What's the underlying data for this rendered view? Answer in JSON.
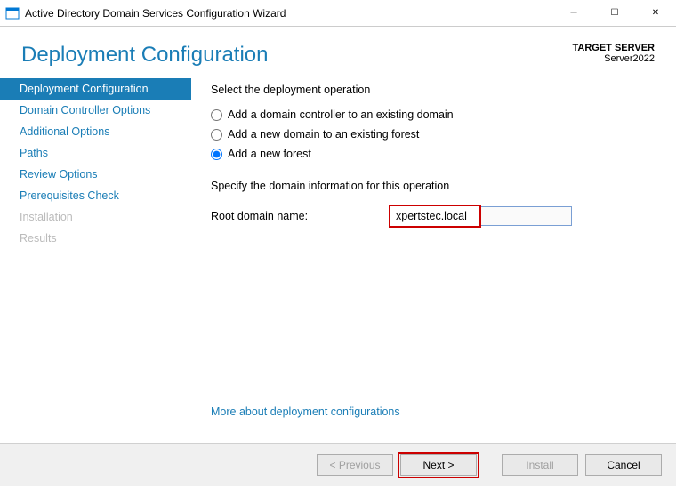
{
  "titlebar": {
    "title": "Active Directory Domain Services Configuration Wizard"
  },
  "header": {
    "page_title": "Deployment Configuration",
    "target_label": "TARGET SERVER",
    "target_server": "Server2022"
  },
  "sidebar": {
    "items": [
      {
        "label": "Deployment Configuration",
        "state": "active"
      },
      {
        "label": "Domain Controller Options",
        "state": "normal"
      },
      {
        "label": "Additional Options",
        "state": "normal"
      },
      {
        "label": "Paths",
        "state": "normal"
      },
      {
        "label": "Review Options",
        "state": "normal"
      },
      {
        "label": "Prerequisites Check",
        "state": "normal"
      },
      {
        "label": "Installation",
        "state": "disabled"
      },
      {
        "label": "Results",
        "state": "disabled"
      }
    ]
  },
  "main": {
    "select_operation_label": "Select the deployment operation",
    "radio_options": [
      {
        "label": "Add a domain controller to an existing domain",
        "checked": false
      },
      {
        "label": "Add a new domain to an existing forest",
        "checked": false
      },
      {
        "label": "Add a new forest",
        "checked": true
      }
    ],
    "specify_label": "Specify the domain information for this operation",
    "root_domain_label": "Root domain name:",
    "root_domain_value": "xpertstec.local",
    "more_link": "More about deployment configurations"
  },
  "footer": {
    "previous": "< Previous",
    "next": "Next >",
    "install": "Install",
    "cancel": "Cancel"
  }
}
